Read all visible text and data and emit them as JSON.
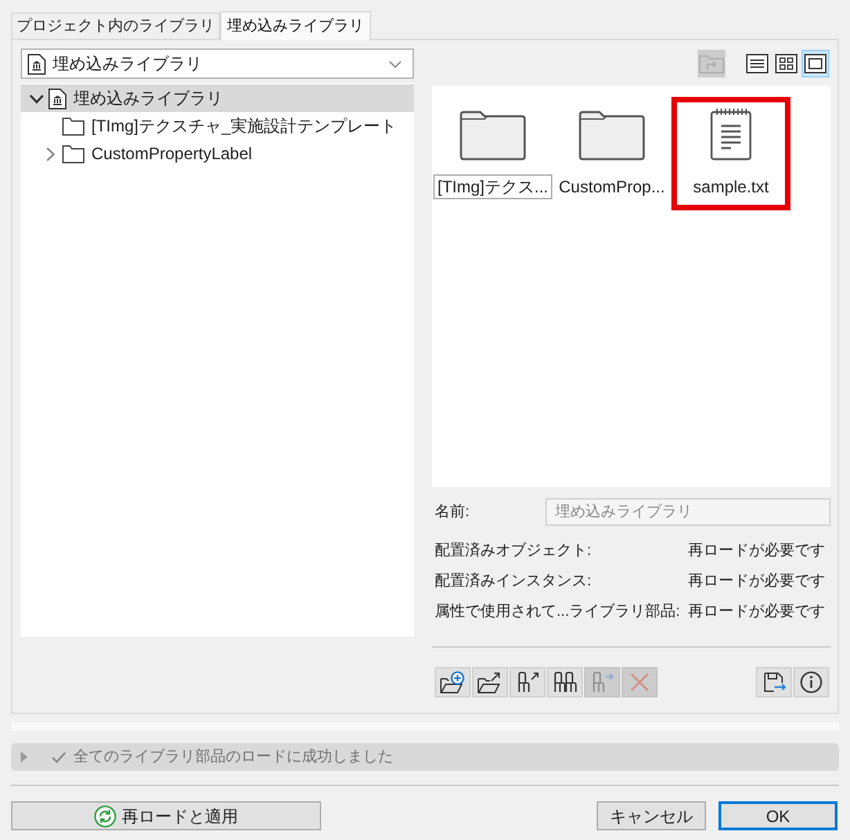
{
  "tabs": [
    {
      "label": "プロジェクト内のライブラリ",
      "selected": false
    },
    {
      "label": "埋め込みライブラリ",
      "selected": true
    }
  ],
  "library_dropdown": {
    "value": "埋め込みライブラリ"
  },
  "tree": [
    {
      "label": "埋め込みライブラリ",
      "kind": "library",
      "expandable": true,
      "expanded": true,
      "selected": true,
      "children": [
        {
          "label": "[TImg]テクスチャ_実施設計テンプレート",
          "kind": "folder",
          "expandable": false,
          "selected": false
        },
        {
          "label": "CustomPropertyLabel",
          "kind": "folder",
          "expandable": true,
          "expanded": false,
          "selected": false
        }
      ]
    }
  ],
  "view_toolbar": [
    {
      "kind": "parent-folder",
      "selected": false,
      "disabled": true
    },
    {
      "kind": "list",
      "selected": false,
      "disabled": false
    },
    {
      "kind": "grid",
      "selected": false,
      "disabled": false
    },
    {
      "kind": "large-icons",
      "selected": true,
      "disabled": false
    }
  ],
  "preview_items": [
    {
      "label": "[TImg]テクス...",
      "kind": "folder",
      "focused": true,
      "highlighted": false
    },
    {
      "label": "CustomProp...",
      "kind": "folder",
      "focused": false,
      "highlighted": false
    },
    {
      "label": "sample.txt",
      "kind": "text-file",
      "focused": false,
      "highlighted": true
    }
  ],
  "properties": {
    "name_label": "名前:",
    "name_field": {
      "value": "埋め込みライブラリ",
      "disabled": true
    },
    "rows": [
      {
        "label": "配置済みオブジェクト:",
        "value": "再ロードが必要です"
      },
      {
        "label": "配置済みインスタンス:",
        "value": "再ロードが必要です"
      },
      {
        "label": "属性で使用されて...ライブラリ部品:",
        "value": "再ロードが必要です"
      }
    ]
  },
  "library_buttons": [
    {
      "kind": "add-folder",
      "disabled": false
    },
    {
      "kind": "open-folder",
      "disabled": false
    },
    {
      "kind": "export-object",
      "disabled": false
    },
    {
      "kind": "objects",
      "disabled": false
    },
    {
      "kind": "move-object",
      "disabled": true
    },
    {
      "kind": "delete",
      "disabled": true
    }
  ],
  "side_buttons": [
    {
      "kind": "save",
      "disabled": false
    },
    {
      "kind": "info",
      "disabled": false
    }
  ],
  "status_bar": {
    "message": "全てのライブラリ部品のロードに成功しました",
    "expanded": false
  },
  "footer_buttons": [
    {
      "label": "再ロードと適用",
      "kind": "reload"
    },
    {
      "label": "キャンセル",
      "kind": "normal"
    },
    {
      "label": "OK",
      "kind": "default"
    }
  ]
}
